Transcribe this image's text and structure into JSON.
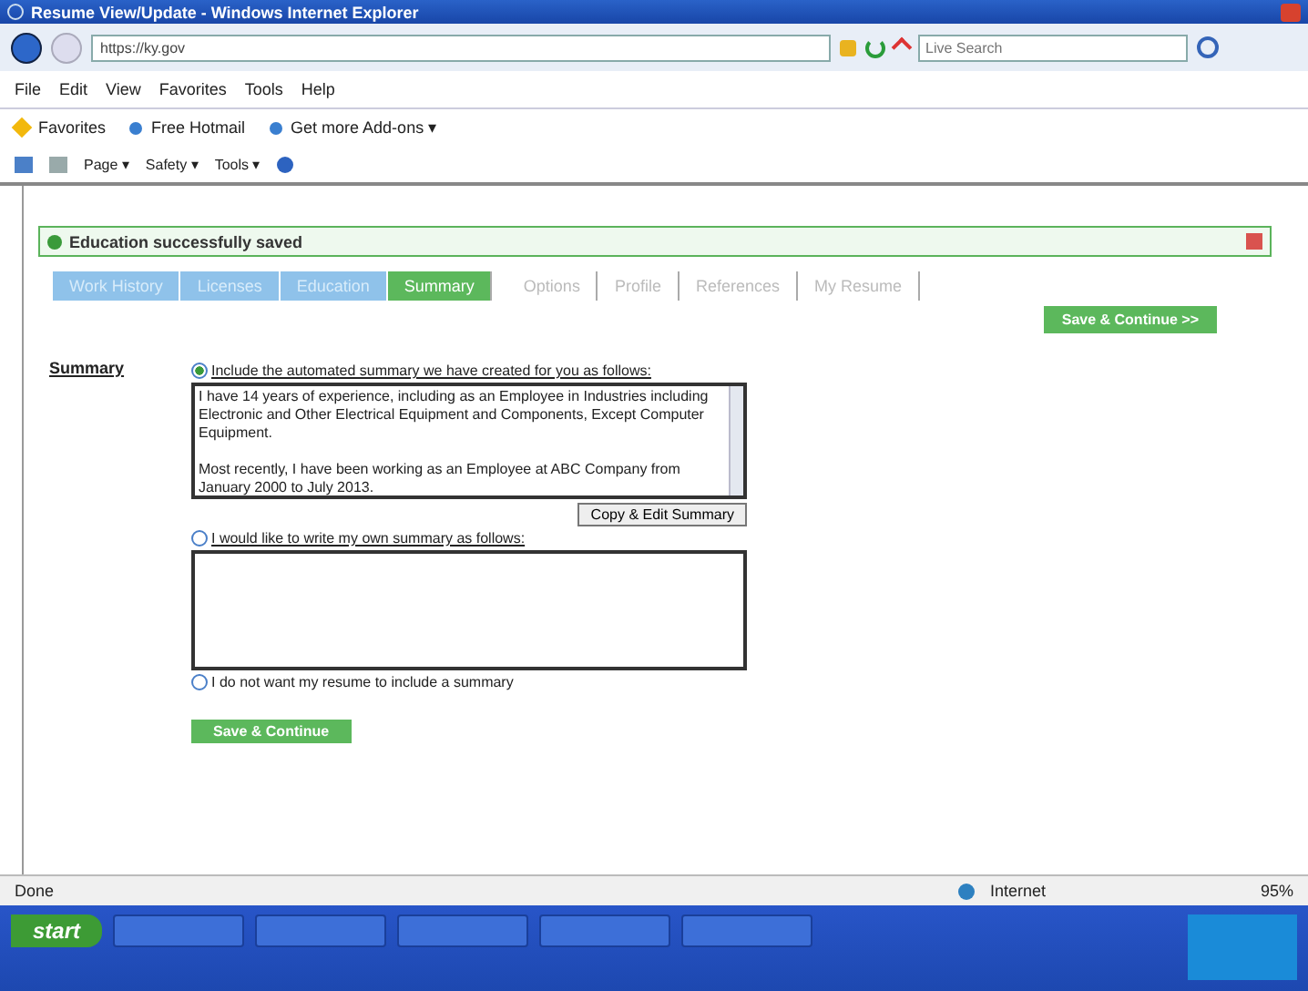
{
  "window": {
    "title": "Resume View/Update - Windows Internet Explorer"
  },
  "address_bar": {
    "url": "https://ky.gov",
    "search_placeholder": "Live Search"
  },
  "menu": [
    "File",
    "Edit",
    "View",
    "Favorites",
    "Tools",
    "Help"
  ],
  "favorites_bar": [
    "Favorites",
    "Free Hotmail",
    "Get more Add-ons ▾"
  ],
  "command_bar": [
    "Page ▾",
    "Safety ▾",
    "Tools ▾"
  ],
  "message": "Education successfully saved",
  "steps": [
    {
      "label": "Work History",
      "completed": true,
      "selected": false
    },
    {
      "label": "Licenses",
      "completed": true,
      "selected": false
    },
    {
      "label": "Education",
      "completed": true,
      "selected": false
    },
    {
      "label": "Summary",
      "completed": false,
      "selected": true
    },
    {
      "label": "Options",
      "completed": false,
      "selected": false
    },
    {
      "label": "Profile",
      "completed": false,
      "selected": false
    },
    {
      "label": "References",
      "completed": false,
      "selected": false
    },
    {
      "label": "My Resume",
      "completed": false,
      "selected": false
    }
  ],
  "top_button": "Save & Continue >>",
  "section_label": "Summary",
  "options": [
    {
      "label": "Include the automated summary we have created for you as follows:",
      "selected": true,
      "kind": "textarea",
      "value": "I have 14 years of experience, including as an Employee in Industries including Electronic and Other Electrical Equipment and Components, Except Computer Equipment.\n\nMost recently, I have been working as an Employee at ABC Company from January 2000 to July 2013.",
      "button": "Copy & Edit Summary"
    },
    {
      "label": "I would like to write my own summary as follows:",
      "selected": false,
      "kind": "textarea"
    },
    {
      "label": "I do not want my resume to include a summary",
      "selected": false,
      "kind": "plain"
    }
  ],
  "bottom_button": "Save & Continue",
  "status_bar": {
    "text": "Done",
    "zone": "Internet",
    "zoom": "95%"
  },
  "taskbar": {
    "start": "start"
  }
}
